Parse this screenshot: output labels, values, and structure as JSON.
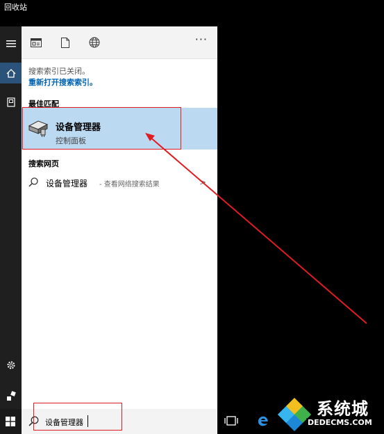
{
  "desktop": {
    "recycle_bin_label": "回收站"
  },
  "rail": {
    "icons": [
      "hamburger-icon",
      "home-icon",
      "document-icon",
      "settings-icon",
      "user-icon",
      "windows-icon"
    ]
  },
  "topbar": {
    "filters": [
      "apps-filter-icon",
      "documents-filter-icon",
      "web-filter-icon"
    ],
    "more_label": "···"
  },
  "notice": {
    "text": "搜索索引已关闭。",
    "link": "重新打开搜索索引。"
  },
  "best_match": {
    "section_title": "最佳匹配",
    "title": "设备管理器",
    "subtitle": "控制面板"
  },
  "web_search": {
    "section_title": "搜索网页",
    "term": "设备管理器",
    "hint": "- 查看网络搜索结果",
    "arrow": ">"
  },
  "search": {
    "value": "设备管理器"
  },
  "watermark": {
    "logo_text": "系统城",
    "site_text": "DEDECMS.COM"
  },
  "colors": {
    "selection": "#bcd9f2",
    "accent": "#0063b1",
    "annotation": "#e01c23"
  }
}
